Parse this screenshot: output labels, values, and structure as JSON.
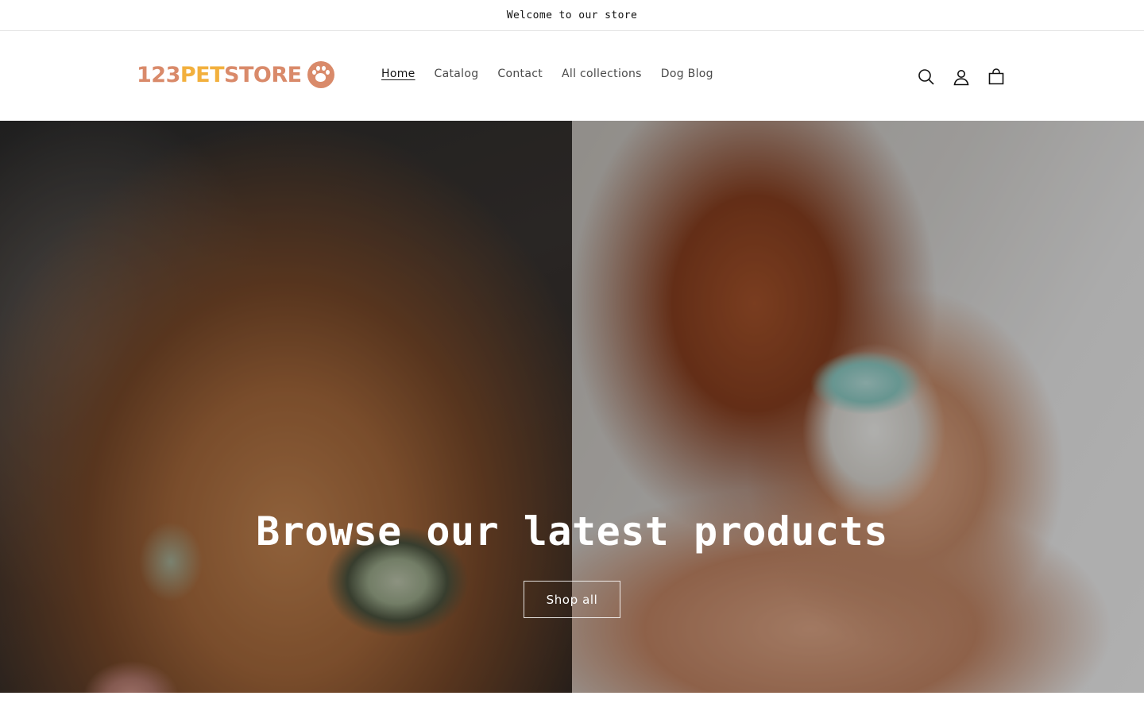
{
  "announcement": {
    "text": "Welcome to our store"
  },
  "header": {
    "logo": {
      "part1": "123",
      "part2": "PET",
      "part3": "STORE",
      "icon": "paw-icon"
    },
    "nav": [
      {
        "label": "Home",
        "active": true
      },
      {
        "label": "Catalog",
        "active": false
      },
      {
        "label": "Contact",
        "active": false
      },
      {
        "label": "All collections",
        "active": false
      },
      {
        "label": "Dog Blog",
        "active": false
      }
    ],
    "icons": [
      "search-icon",
      "account-icon",
      "cart-icon"
    ]
  },
  "hero": {
    "title": "Browse our latest products",
    "button_label": "Shop all",
    "left_image": "cat-closeup",
    "right_image": "poodle-with-cup"
  },
  "colors": {
    "logo_primary": "#d98a6a",
    "logo_accent": "#f2b03d",
    "text": "#121212",
    "nav_text": "#4a4a4a"
  }
}
